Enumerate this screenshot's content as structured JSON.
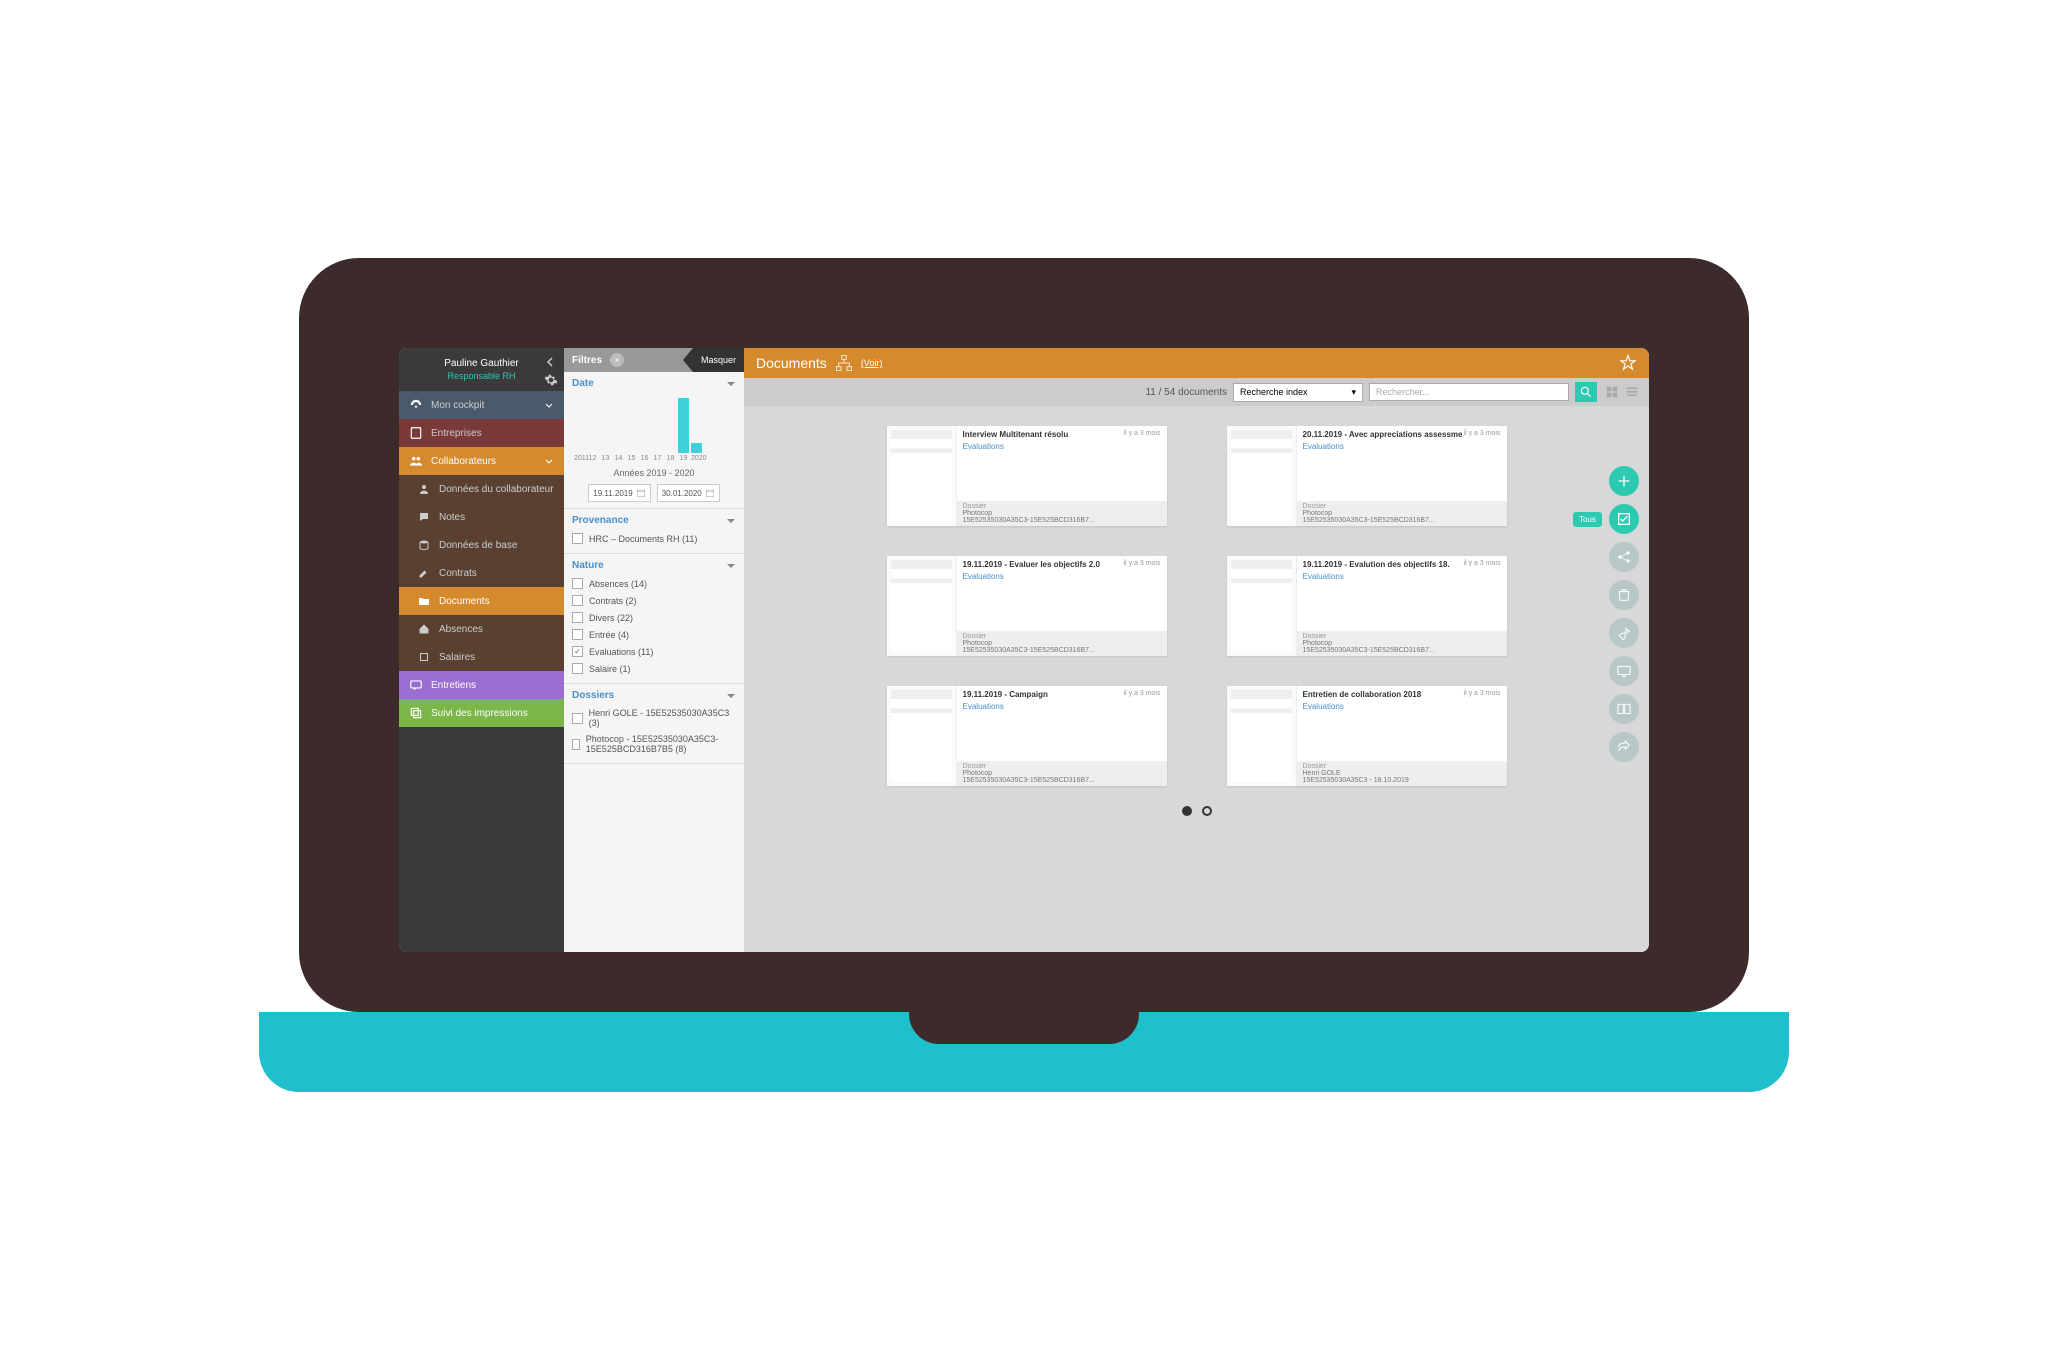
{
  "user": {
    "name": "Pauline Gauthier",
    "role": "Responsable RH"
  },
  "sidebar": {
    "cockpit": "Mon cockpit",
    "entreprises": "Entreprises",
    "collaborateurs": "Collaborateurs",
    "donnees_collab": "Données du collaborateur",
    "notes": "Notes",
    "donnees_base": "Données de base",
    "contrats": "Contrats",
    "documents": "Documents",
    "absences": "Absences",
    "salaires": "Salaires",
    "entretiens": "Entretiens",
    "suivi": "Suivi des impressions"
  },
  "filters": {
    "title": "Filtres",
    "masquer": "Masquer",
    "date_label": "Date",
    "range_label": "Années 2019 - 2020",
    "date_from": "19.11.2019",
    "date_to": "30.01.2020",
    "provenance_label": "Provenance",
    "provenance_items": [
      "HRC – Documents RH (11)"
    ],
    "nature_label": "Nature",
    "nature_items": [
      {
        "label": "Absences (14)",
        "checked": false
      },
      {
        "label": "Contrats (2)",
        "checked": false
      },
      {
        "label": "Divers (22)",
        "checked": false
      },
      {
        "label": "Entrée (4)",
        "checked": false
      },
      {
        "label": "Evaluations (11)",
        "checked": true
      },
      {
        "label": "Salaire (1)",
        "checked": false
      }
    ],
    "dossiers_label": "Dossiers",
    "dossiers_items": [
      "Henri GOLE - 15E52535030A35C3 (3)",
      "Photocop - 15E52535030A35C3-15E525BCD316B7B5 (8)"
    ]
  },
  "chart_data": {
    "type": "bar",
    "categories": [
      "2011",
      "12",
      "13",
      "14",
      "15",
      "16",
      "17",
      "18",
      "19",
      "2020"
    ],
    "values": [
      0,
      0,
      0,
      0,
      0,
      0,
      0,
      0,
      55,
      10
    ],
    "title": "Date",
    "xlabel": "",
    "ylabel": "",
    "ylim": [
      0,
      60
    ]
  },
  "header": {
    "title": "Documents",
    "voir": "(Voir)"
  },
  "toolbar": {
    "count": "11 / 54 documents",
    "index_dropdown": "Recherche index",
    "search_placeholder": "Rechercher..."
  },
  "actions": {
    "tous": "Tous"
  },
  "documents": [
    {
      "title": "Interview Multitenant résolu",
      "tag": "Evaluations",
      "time": "il y a 3 mois",
      "folder_label": "Dossier",
      "folder1": "Photocop",
      "folder2": "15E52535030A35C3-15E525BCD316B7..."
    },
    {
      "title": "20.11.2019 - Avec appreciations assessme",
      "tag": "Evaluations",
      "time": "il y a 3 mois",
      "folder_label": "Dossier",
      "folder1": "Photocop",
      "folder2": "15E52535030A35C3-15E525BCD316B7..."
    },
    {
      "title": "19.11.2019 - Evaluer les objectifs 2.0",
      "tag": "Evaluations",
      "time": "il y a 3 mois",
      "folder_label": "Dossier",
      "folder1": "Photocop",
      "folder2": "15E52535030A35C3-15E525BCD316B7..."
    },
    {
      "title": "19.11.2019 - Evalution des objectifs 18.",
      "tag": "Evaluations",
      "time": "il y a 3 mois",
      "folder_label": "Dossier",
      "folder1": "Photocop",
      "folder2": "15E52535030A35C3-15E525BCD316B7..."
    },
    {
      "title": "19.11.2019 - Campaign",
      "tag": "Evaluations",
      "time": "il y a 3 mois",
      "folder_label": "Dossier",
      "folder1": "Photocop",
      "folder2": "15E52535030A35C3-15E525BCD316B7..."
    },
    {
      "title": "Entretien de collaboration 2018",
      "tag": "Evaluations",
      "time": "il y a 3 mois",
      "folder_label": "Dossier",
      "folder1": "Henri GOLE",
      "folder2": "15E52535030A35C3 - 18.10.2019"
    }
  ]
}
